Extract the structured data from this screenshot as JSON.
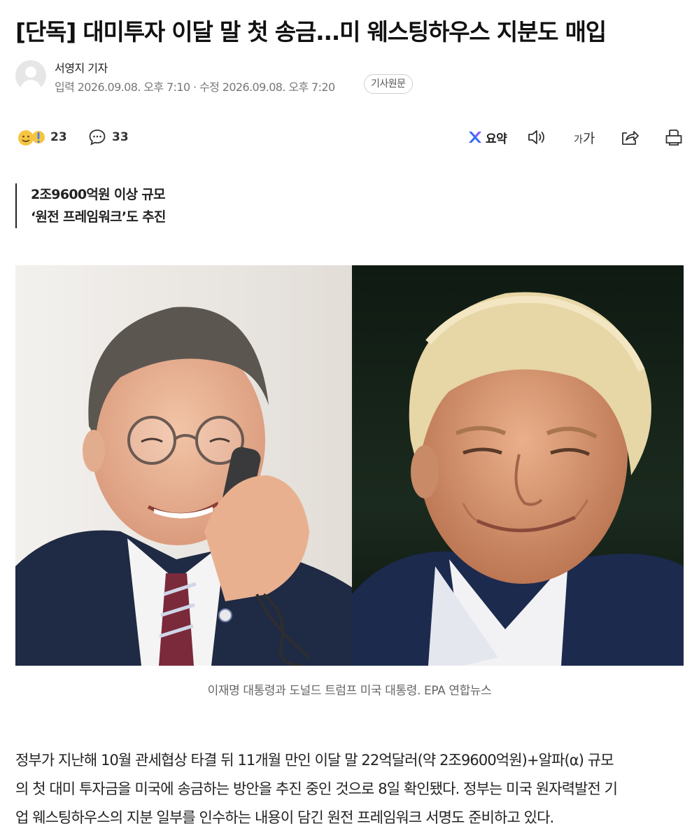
{
  "article": {
    "headline": "[단독] 대미투자 이달 말 첫 송금...미 웨스팅하우스 지분도 매입",
    "reporter": "서영지 기자",
    "dates": "입력 2026.09.08. 오후 7:10 · 수정 2026.09.08. 오후 7:20",
    "original_link_label": "기사원문",
    "subheads": [
      "2조9600억원 이상 규모",
      "‘원전 프레임워크’도 추진"
    ],
    "photo_caption": "이재명 대통령과 도널드 트럼프 미국 대통령. EPA 연합뉴스",
    "body_lines": [
      "정부가 지난해 10월 관세협상 타결 뒤 11개월 만인 이달 말 22억달러(약 2조9600억원)+알파(α) 규모",
      "의 첫 대미 투자금을 미국에 송금하는 방안을 추진 중인 것으로 8일 확인됐다. 정부는 미국 원자력발전 기",
      "업 웨스팅하우스의 지분 일부를 인수하는 내용이 담긴 원전 프레임워크 서명도 준비하고 있다."
    ]
  },
  "toolbar": {
    "reaction_count": "23",
    "comment_count": "33",
    "summary_label": "요약",
    "font_size_label_small": "가",
    "font_size_label_large": "가"
  },
  "icons": {
    "reaction": "emoji-reaction-icon",
    "comment": "speech-bubble-icon",
    "summary": "ai-summary-icon",
    "audio": "speaker-icon",
    "share": "share-icon",
    "print": "print-icon"
  },
  "colors": {
    "summary_accent": "#3b6cf6",
    "emoji_yellow": "#f5c542",
    "emoji_blue": "#3b82f6"
  }
}
